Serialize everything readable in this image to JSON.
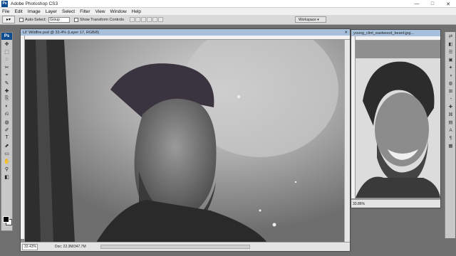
{
  "app": {
    "title": "Adobe Photoshop CS3",
    "badge": "Ps",
    "controls": {
      "minimize": "—",
      "maximize": "□",
      "close": "✕"
    }
  },
  "menu": [
    "File",
    "Edit",
    "Image",
    "Layer",
    "Select",
    "Filter",
    "View",
    "Window",
    "Help"
  ],
  "options": {
    "auto_select_label": "Auto-Select:",
    "auto_select_value": "Group",
    "transform_label": "Show Transform Controls",
    "workspace_label": "Workspace ▾"
  },
  "toolbox": {
    "badge": "Ps",
    "tools": [
      "✥",
      "⬚",
      "◌",
      "✂",
      "⌖",
      "✎",
      "✚",
      "⎘",
      "◐",
      "⎌",
      "◍",
      "✐",
      "T",
      "⬈",
      "▭",
      "✋",
      "⚲",
      "◧"
    ]
  },
  "document": {
    "tab_title": "Lil' Wildfire.psd @ 33.4% (Layer 17, RGB/8)",
    "zoom": "33.43%",
    "info": "Doc: 22.3M/347.7M",
    "close_label": "✕"
  },
  "secondary": {
    "tab_title": "young_clint_eastwood_beard.jpg...",
    "zoom": "33.86%"
  },
  "panels": [
    "⇄",
    "◧",
    "☰",
    "▣",
    "✦",
    "◑",
    "◍",
    "⊞",
    "◔",
    "✚",
    "⌘",
    "▤",
    "A",
    "¶",
    "▦"
  ],
  "colors": {
    "foreground": "#000000",
    "background": "#ffffff",
    "tab": "#a9c0dc"
  }
}
